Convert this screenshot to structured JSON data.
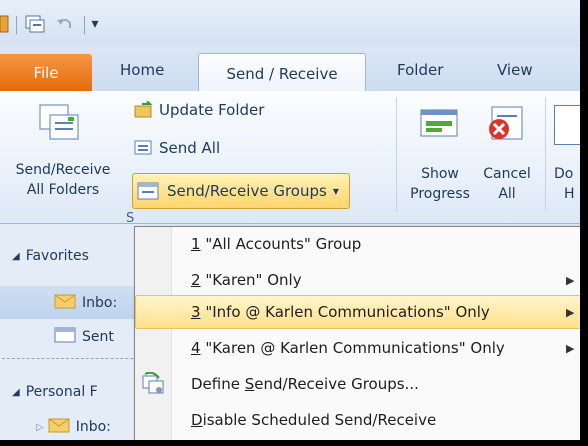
{
  "qat": {
    "icons": [
      "outlook-app-icon",
      "send-receive-all-icon",
      "undo-icon",
      "customize-qat-icon"
    ],
    "customize_glyph": "▾"
  },
  "tabs": {
    "file": "File",
    "home": "Home",
    "send_receive": "Send / Receive",
    "folder": "Folder",
    "view": "View"
  },
  "ribbon": {
    "send_receive_all": [
      "Send/Receive",
      "All Folders"
    ],
    "update_folder": "Update Folder",
    "send_all": "Send All",
    "send_receive_groups": "Send/Receive Groups",
    "dropdown_glyph": "▾",
    "show_progress": [
      "Show",
      "Progress"
    ],
    "cancel_all": [
      "Cancel",
      "All"
    ],
    "download_partial": [
      "Do",
      "H"
    ],
    "group_footer_partial": "S"
  },
  "nav": {
    "favorites": "Favorites",
    "inbox": "Inbo:",
    "sent": "Sent",
    "personal": "Personal F",
    "inbox2": "Inbo:"
  },
  "menu": {
    "items": [
      {
        "key": "1",
        "label": " \"All Accounts\" Group",
        "submenu": false
      },
      {
        "key": "2",
        "label": " \"Karen\" Only",
        "submenu": true
      },
      {
        "key": "3",
        "label": " \"Info @ Karlen Communications\" Only",
        "submenu": true,
        "highlighted": true
      },
      {
        "key": "4",
        "label": " \"Karen @ Karlen Communications\" Only",
        "submenu": true
      },
      {
        "pre": "Define ",
        "key": "S",
        "label": "end/Receive Groups...",
        "submenu": false,
        "icon": "define-groups-icon"
      },
      {
        "pre": "",
        "key": "D",
        "label": "isable Scheduled Send/Receive",
        "submenu": false
      }
    ],
    "arrow_glyph": "▶"
  },
  "colors": {
    "file_tab": "#e46c0a",
    "highlight": "#ffe08a",
    "ribbon_text": "#1e395b"
  }
}
